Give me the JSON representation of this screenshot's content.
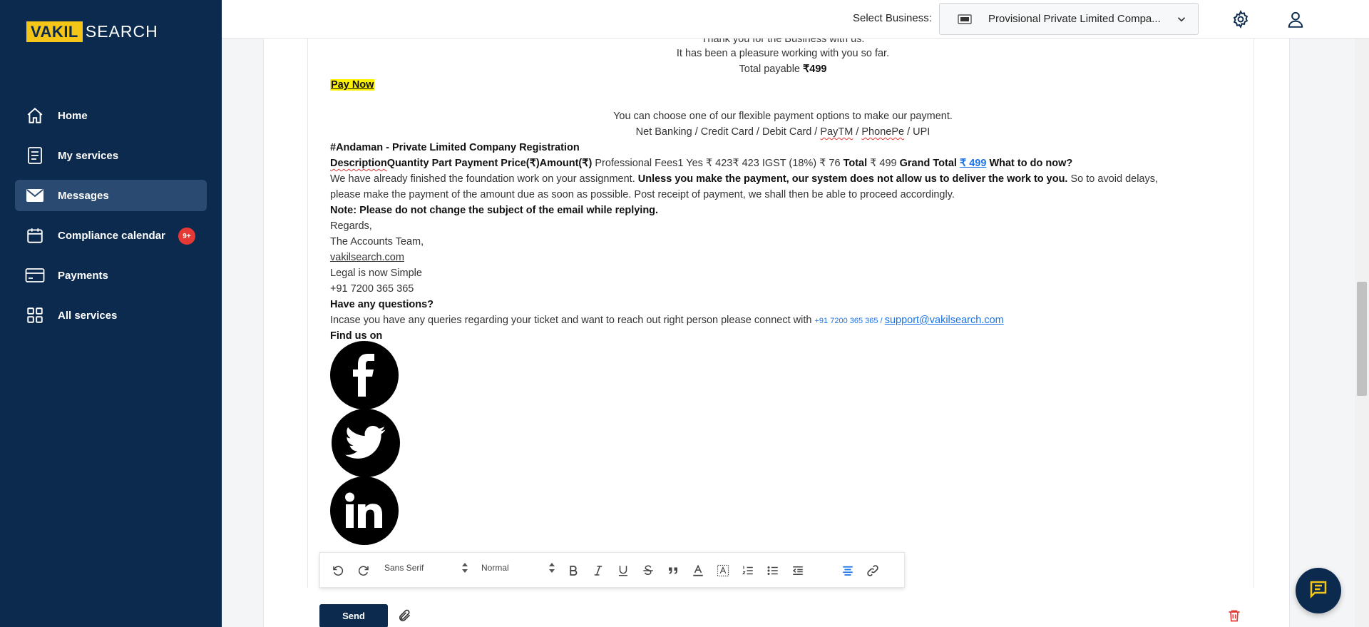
{
  "brand": {
    "part1": "VAKIL",
    "part2": "SEARCH"
  },
  "sidebar": {
    "items": [
      {
        "label": "Home",
        "icon": "home-icon"
      },
      {
        "label": "My services",
        "icon": "document-list-icon"
      },
      {
        "label": "Messages",
        "icon": "mail-icon",
        "active": true
      },
      {
        "label": "Compliance calendar",
        "icon": "calendar-icon",
        "badge": "9+"
      },
      {
        "label": "Payments",
        "icon": "credit-card-icon"
      },
      {
        "label": "All services",
        "icon": "grid-icon"
      }
    ]
  },
  "header": {
    "select_label": "Select Business:",
    "business_value": "Provisional Private Limited Compa...",
    "icons": [
      "gear-icon",
      "user-icon"
    ]
  },
  "email": {
    "thank_line": "Thank you for the Business with us.",
    "pleasure_line": "It has been a pleasure working with you so far.",
    "total_payable_label": "Total payable ",
    "total_payable_value": "₹499",
    "pay_now": "Pay Now",
    "payment_options_line": "You can choose one of our flexible payment options to make our payment.",
    "payment_methods": {
      "a": "Net Banking / Credit Card / Debit Card / ",
      "paytm": "PayTM",
      "sep": " / ",
      "phonepe": "PhonePe",
      "upi": " / UPI"
    },
    "order_title": " #Andaman - Private Limited Company Registration",
    "table_line": {
      "description": "Description",
      "headers_rest": "Quantity Part Payment Price(₹)Amount(₹)",
      "row": " Professional Fees1 Yes ₹ 423₹ 423  IGST (18%) ₹ 76   ",
      "total_label": "Total",
      "total_value": "  ₹ 499    ",
      "grand_total_label": "Grand Total ",
      "grand_total_value": "₹ 499",
      "what_next": "  What to do now?"
    },
    "para1_a": "We have already finished the foundation work on your assignment. ",
    "para1_bold": "Unless you make the payment, our system does not allow us to deliver the work to you.",
    "para1_b": " So to avoid delays,",
    "para2": "please make the payment of the amount due as soon as possible. Post receipt of payment, we shall then be able to proceed accordingly.",
    "note": " Note: Please do not change the subject of the email while replying.",
    "regards": "Regards,",
    "team": " The Accounts Team,",
    "site": "vakilsearch.com",
    "tagline": "Legal is now Simple",
    "phone": "+91 7200 365 365",
    "questions_title": "Have any questions?",
    "questions_text": "Incase you have any queries regarding your ticket and want to reach out right person please connect with ",
    "questions_phone": "+91 7200 365 365 / ",
    "support_email": "support@vakilsearch.com",
    "find_us": "Find us on",
    "socials": [
      "facebook-icon",
      "twitter-icon",
      "linkedin-icon"
    ]
  },
  "editor": {
    "font_family": "Sans Serif",
    "font_size": "Normal",
    "send_label": "Send"
  },
  "colors": {
    "sidebar_bg": "#0b2a4e",
    "active_item": "#2b4a72",
    "brand_yellow": "#f5c518",
    "link_blue": "#1a73e8",
    "badge_red": "#e53935"
  }
}
